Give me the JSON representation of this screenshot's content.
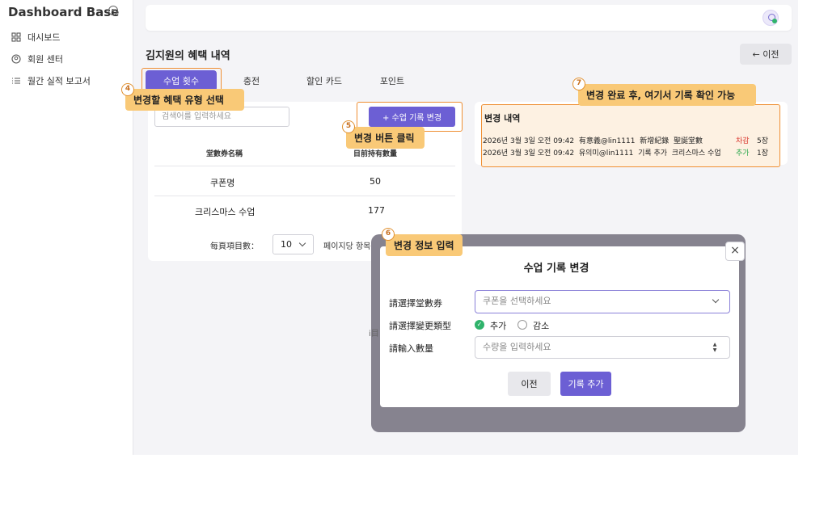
{
  "sidebar": {
    "brand": "Dashboard Base",
    "items": [
      {
        "label": "대시보드",
        "icon": "grid-icon"
      },
      {
        "label": "회원 센터",
        "icon": "user-circle-icon"
      },
      {
        "label": "월간 실적 보고서",
        "icon": "list-icon"
      }
    ]
  },
  "header": {
    "page_title": "김지원의 혜택 내역",
    "back_label": "← 이전"
  },
  "tabs": [
    {
      "label": "수업 횟수",
      "active": true
    },
    {
      "label": "충전"
    },
    {
      "label": "할인 카드"
    },
    {
      "label": "포인트"
    }
  ],
  "left_panel": {
    "search_placeholder": "검색어를 입력하세요",
    "add_button": "+ 수업 기록 변경",
    "columns": [
      "堂數券名稱",
      "目前持有數量"
    ],
    "rows": [
      {
        "name": "쿠폰명",
        "qty": "50"
      },
      {
        "name": "크리스마스 수업",
        "qty": "177"
      }
    ],
    "pager_label": "每頁項目數：",
    "page_size": "10",
    "per_page_label": "페이지당 항목 수"
  },
  "history": {
    "title": "변경 내역",
    "rows": [
      {
        "time": "2026년 3월 3일 오전 09:42",
        "user": "有意義@lin1111",
        "action": "新增紀錄",
        "item": "聖誕堂數",
        "type": "차감",
        "type_color": "#d9342b",
        "qty": "5장"
      },
      {
        "time": "2026년 3월 3일 오전 09:42",
        "user": "유의미@lin1111",
        "action": "기록 추가",
        "item": "크리스마스 수업",
        "type": "추가",
        "type_color": "#2fa84f",
        "qty": "1장"
      }
    ]
  },
  "modal": {
    "title": "수업 기록 변경",
    "close": "×",
    "coupon_label": "請選擇堂數券",
    "coupon_placeholder": "쿠폰을 선택하세요",
    "type_label": "請選擇變更類型",
    "type_add": "추가",
    "type_sub": "감소",
    "qty_label": "請輸入數量",
    "qty_placeholder": "수량을 입력하세요",
    "prev_button": "이전",
    "add_button": "기록 추가"
  },
  "callouts": [
    {
      "step": "4",
      "text": "변경할 혜택 유형 선택"
    },
    {
      "step": "5",
      "text": "변경 버튼 클릭"
    },
    {
      "step": "6",
      "text": "변경 정보 입력"
    },
    {
      "step": "7",
      "text": "변경 완료 후, 여기서 기록 확인 가능"
    }
  ],
  "colors": {
    "accent": "#6c5fd4",
    "highlight": "#ef8f34",
    "callout": "#f9c977"
  }
}
